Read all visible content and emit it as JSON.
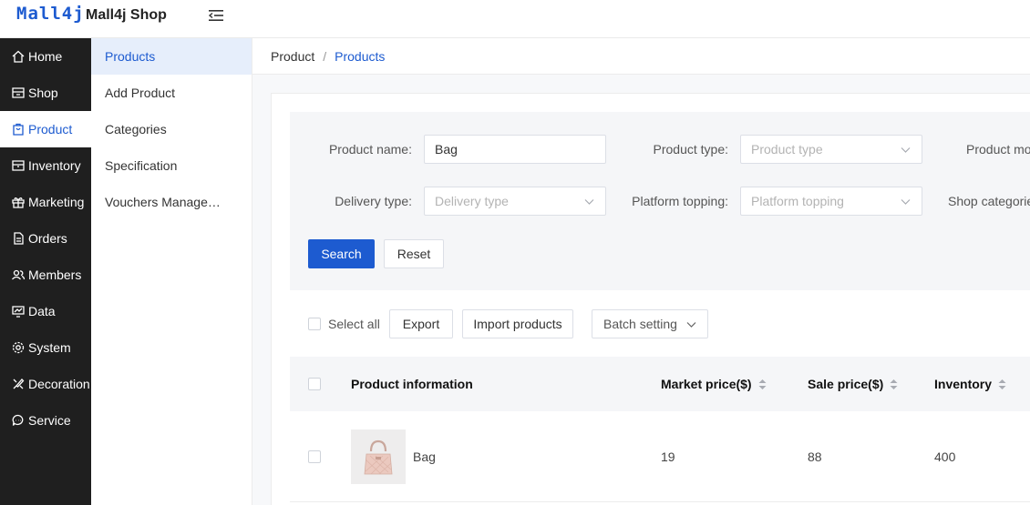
{
  "header": {
    "logo": "Mall4j",
    "shop_name": "Mall4j Shop",
    "collapse_icon": "menu-fold-icon"
  },
  "sidebar": {
    "items": [
      {
        "label": "Home",
        "icon": "home-icon"
      },
      {
        "label": "Shop",
        "icon": "shop-icon"
      },
      {
        "label": "Product",
        "icon": "product-icon",
        "active": true
      },
      {
        "label": "Inventory",
        "icon": "inventory-icon"
      },
      {
        "label": "Marketing",
        "icon": "gift-icon"
      },
      {
        "label": "Orders",
        "icon": "document-icon"
      },
      {
        "label": "Members",
        "icon": "members-icon"
      },
      {
        "label": "Data",
        "icon": "chart-icon"
      },
      {
        "label": "System",
        "icon": "gear-icon"
      },
      {
        "label": "Decoration",
        "icon": "brush-icon"
      },
      {
        "label": "Service",
        "icon": "chat-icon"
      }
    ]
  },
  "submenu": {
    "items": [
      {
        "label": "Products",
        "active": true
      },
      {
        "label": "Add Product"
      },
      {
        "label": "Categories"
      },
      {
        "label": "Specification"
      },
      {
        "label": "Vouchers Manage…"
      }
    ]
  },
  "breadcrumb": {
    "parent": "Product",
    "separator": "/",
    "current": "Products"
  },
  "filters": {
    "product_name": {
      "label": "Product name:",
      "value": "Bag"
    },
    "product_type": {
      "label": "Product type:",
      "placeholder": "Product type"
    },
    "product_mode": {
      "label": "Product mo"
    },
    "delivery_type": {
      "label": "Delivery type:",
      "placeholder": "Delivery type"
    },
    "platform_topping": {
      "label": "Platform topping:",
      "placeholder": "Platform topping"
    },
    "shop_categories": {
      "label": "Shop categorie"
    },
    "search_label": "Search",
    "reset_label": "Reset"
  },
  "toolbar": {
    "select_all": "Select all",
    "export": "Export",
    "import": "Import products",
    "batch": "Batch setting"
  },
  "table": {
    "columns": [
      "Product information",
      "Market price($)",
      "Sale price($)",
      "Inventory"
    ],
    "rows": [
      {
        "name": "Bag",
        "market_price": "19",
        "sale_price": "88",
        "inventory": "400"
      }
    ]
  },
  "colors": {
    "primary": "#1d5bd0",
    "sidebar_bg": "#1f1f1f"
  }
}
